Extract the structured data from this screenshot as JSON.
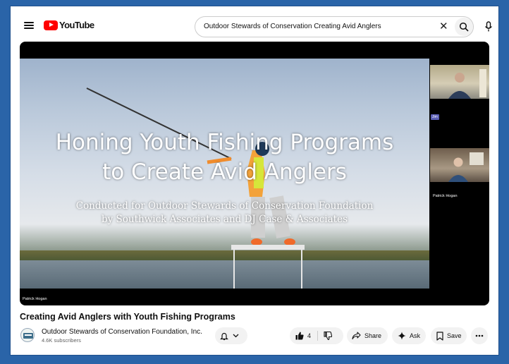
{
  "brand": {
    "wordmark": "YouTube"
  },
  "search": {
    "query": "Outdoor Stewards of Conservation Creating Avid Anglers"
  },
  "player": {
    "slide_title_line1": "Honing Youth Fishing Programs",
    "slide_title_line2": "to Create Avid Anglers",
    "slide_subtitle_line1": "Conducted for Outdoor Stewards of Conservation Foundation",
    "slide_subtitle_line2": "by Southwick Associates and DJ Case & Associates",
    "presenter_label": "Patrick Hogan",
    "participant_tag": "Jim",
    "participant_name": "Patrick Hogan"
  },
  "video": {
    "title": "Creating Avid Anglers with Youth Fishing Programs"
  },
  "channel": {
    "name": "Outdoor Stewards of Conservation Foundation, Inc.",
    "subscribers": "4.6K subscribers"
  },
  "actions": {
    "like_count": "4",
    "share_label": "Share",
    "ask_label": "Ask",
    "save_label": "Save"
  },
  "icons": {
    "menu": "hamburger-icon",
    "clear": "close-icon",
    "search": "search-icon",
    "mic": "mic-icon",
    "bell": "bell-icon",
    "like": "thumbs-up-icon",
    "dislike": "thumbs-down-icon",
    "share": "share-icon",
    "ask": "sparkle-icon",
    "save": "bookmark-icon",
    "more": "more-horizontal-icon"
  },
  "colors": {
    "brand_red": "#ff0000",
    "page_border": "#2a64a8"
  }
}
